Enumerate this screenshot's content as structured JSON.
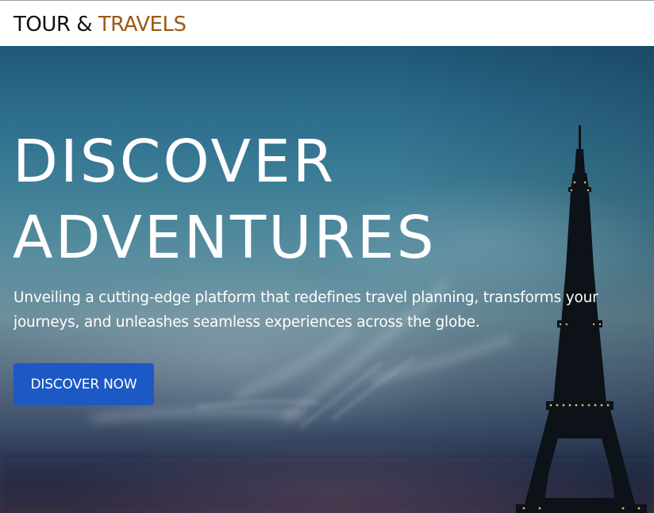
{
  "brand": {
    "part1": "TOUR & ",
    "part2": "TRAVELS",
    "color_primary": "#111111",
    "color_accent": "#9a5a14"
  },
  "hero": {
    "title_line1": "DISCOVER",
    "title_line2": "ADVENTURES",
    "description": "Unveiling a cutting-edge platform that redefines travel planning, transforms your journeys, and unleashes seamless experiences across the globe.",
    "cta_label": "DISCOVER NOW",
    "cta_color": "#1c59c4",
    "background_image": "eiffel-tower-dusk-sky"
  }
}
